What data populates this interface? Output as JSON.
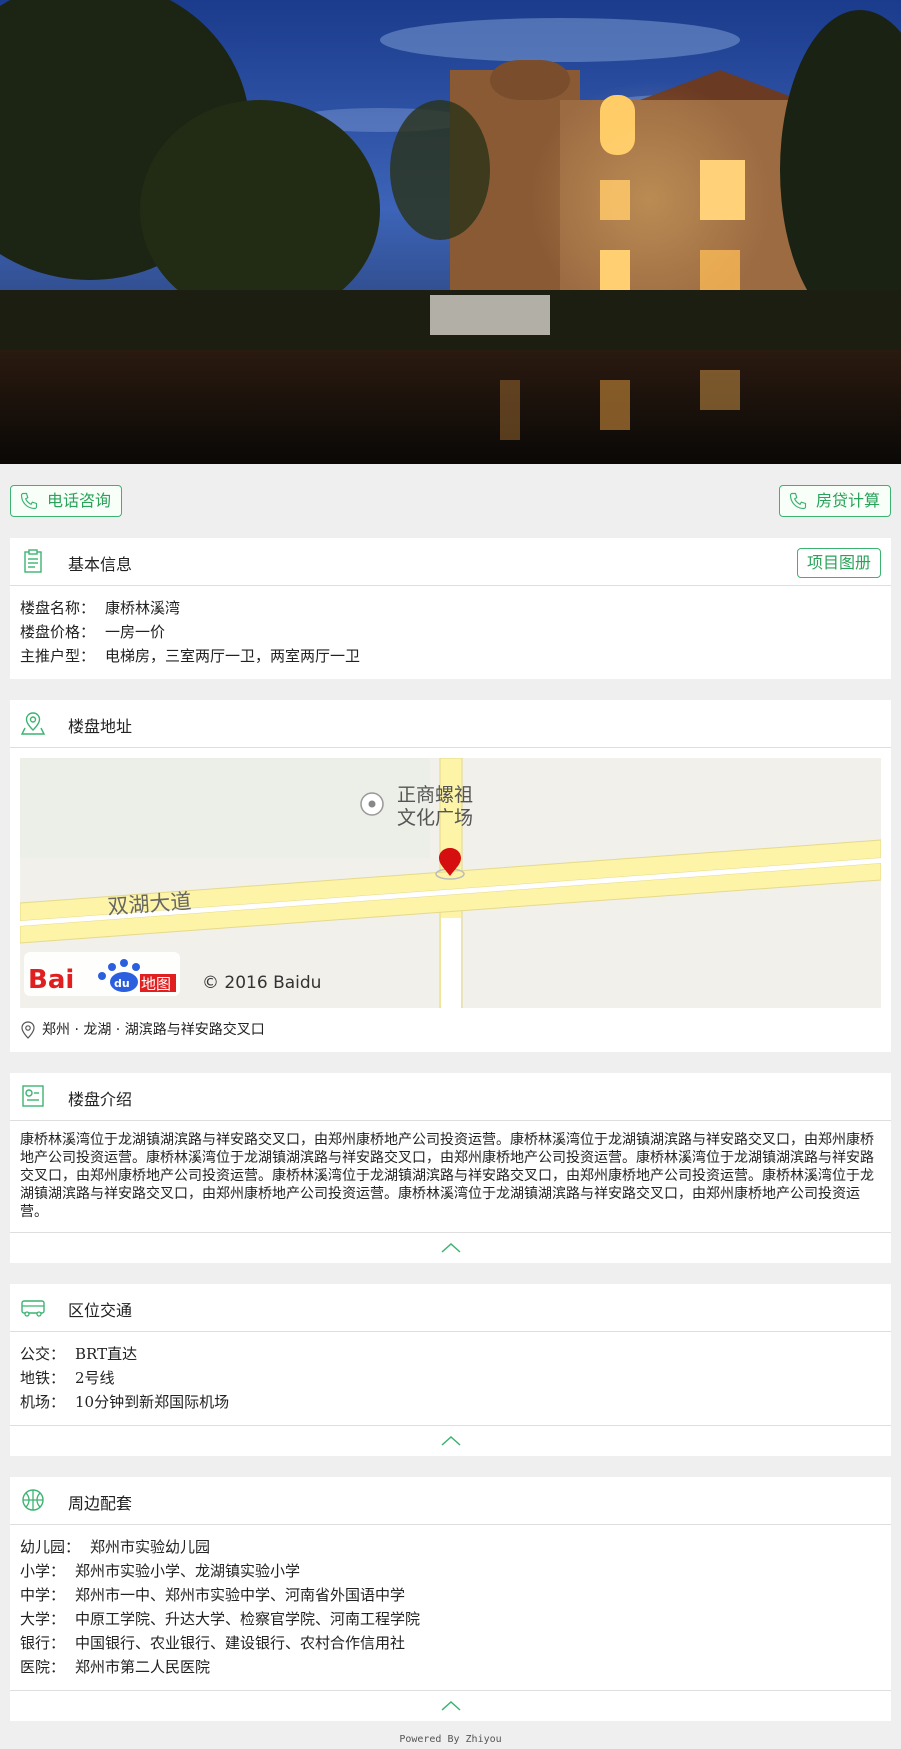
{
  "colors": {
    "accent": "#3cb371",
    "accent_text": "#2aa35a",
    "page_bg": "#efefef"
  },
  "hero": {
    "image": "villa-night-photo"
  },
  "actions": {
    "call_label": "电话咨询",
    "loan_label": "房贷计算"
  },
  "basic": {
    "title": "基本信息",
    "album_label": "项目图册",
    "rows": [
      {
        "key": "楼盘名称：",
        "value": "康桥林溪湾"
      },
      {
        "key": "楼盘价格：",
        "value": "一房一价"
      },
      {
        "key": "主推户型：",
        "value": "电梯房，三室两厅一卫，两室两厅一卫"
      }
    ]
  },
  "address": {
    "title": "楼盘地址",
    "map": {
      "poi": [
        "正商螺祖",
        "文化广场"
      ],
      "road": "双湖大道",
      "copyright": "© 2016 Baidu",
      "logo_text": "Bai",
      "logo_du": "du",
      "logo_map": "地图"
    },
    "text": "郑州 · 龙湖 · 湖滨路与祥安路交叉口"
  },
  "intro": {
    "title": "楼盘介绍",
    "text": "康桥林溪湾位于龙湖镇湖滨路与祥安路交叉口，由郑州康桥地产公司投资运营。康桥林溪湾位于龙湖镇湖滨路与祥安路交叉口，由郑州康桥地产公司投资运营。康桥林溪湾位于龙湖镇湖滨路与祥安路交叉口，由郑州康桥地产公司投资运营。康桥林溪湾位于龙湖镇湖滨路与祥安路交叉口，由郑州康桥地产公司投资运营。康桥林溪湾位于龙湖镇湖滨路与祥安路交叉口，由郑州康桥地产公司投资运营。康桥林溪湾位于龙湖镇湖滨路与祥安路交叉口，由郑州康桥地产公司投资运营。康桥林溪湾位于龙湖镇湖滨路与祥安路交叉口，由郑州康桥地产公司投资运营。"
  },
  "traffic": {
    "title": "区位交通",
    "rows": [
      {
        "key": "公交：",
        "value": "BRT直达"
      },
      {
        "key": "地铁：",
        "value": "2号线"
      },
      {
        "key": "机场：",
        "value": "10分钟到新郑国际机场"
      }
    ]
  },
  "facilities": {
    "title": "周边配套",
    "rows": [
      {
        "key": "幼儿园：",
        "value": "郑州市实验幼儿园"
      },
      {
        "key": "小学：",
        "value": "郑州市实验小学、龙湖镇实验小学"
      },
      {
        "key": "中学：",
        "value": "郑州市一中、郑州市实验中学、河南省外国语中学"
      },
      {
        "key": "大学：",
        "value": "中原工学院、升达大学、检察官学院、河南工程学院"
      },
      {
        "key": "银行：",
        "value": "中国银行、农业银行、建设银行、农村合作信用社"
      },
      {
        "key": "医院：",
        "value": "郑州市第二人民医院"
      }
    ]
  },
  "footer": {
    "text": "Powered By Zhiyou"
  }
}
